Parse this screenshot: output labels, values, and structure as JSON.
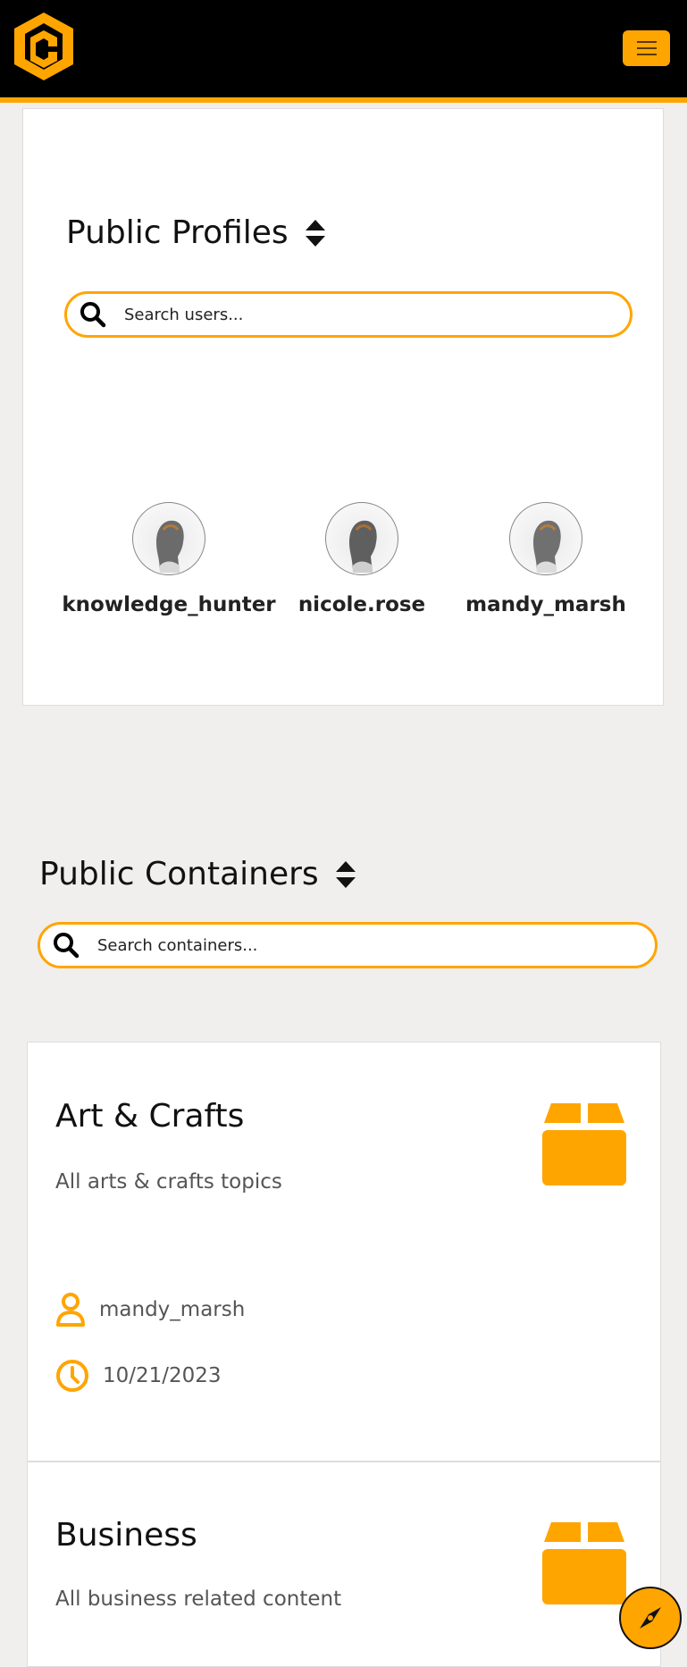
{
  "header": {
    "logo_name": "site-logo",
    "menu_icon": "hamburger-icon"
  },
  "profiles": {
    "title": "Public Profiles",
    "search_placeholder": "Search users...",
    "users": [
      {
        "name": "knowledge_hunter"
      },
      {
        "name": "nicole.rose"
      },
      {
        "name": "mandy_marsh"
      }
    ]
  },
  "containers": {
    "title": "Public Containers",
    "search_placeholder": "Search containers...",
    "items": [
      {
        "title": "Art & Crafts",
        "description": "All arts & crafts topics",
        "owner": "mandy_marsh",
        "date": "10/21/2023"
      },
      {
        "title": "Business",
        "description": "All business related content"
      }
    ]
  },
  "colors": {
    "accent": "#ffa500",
    "header_bg": "#000000",
    "page_bg": "#f1eeee"
  },
  "fab": {
    "icon": "compass-icon"
  }
}
